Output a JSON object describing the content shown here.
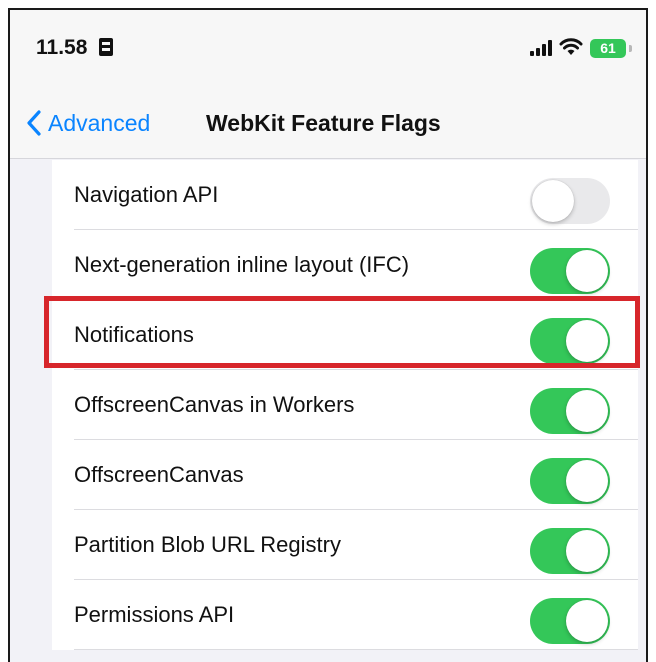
{
  "status_bar": {
    "time": "11.58",
    "battery": "61"
  },
  "nav": {
    "back_label": "Advanced",
    "title": "WebKit Feature Flags"
  },
  "settings": [
    {
      "label": "Navigation API",
      "enabled": false
    },
    {
      "label": "Next-generation inline layout (IFC)",
      "enabled": true
    },
    {
      "label": "Notifications",
      "enabled": true,
      "highlighted": true
    },
    {
      "label": "OffscreenCanvas in Workers",
      "enabled": true
    },
    {
      "label": "OffscreenCanvas",
      "enabled": true
    },
    {
      "label": "Partition Blob URL Registry",
      "enabled": true
    },
    {
      "label": "Permissions API",
      "enabled": true
    }
  ],
  "colors": {
    "accent": "#0a84ff",
    "toggle_on": "#34c759",
    "toggle_off": "#e9e9eb",
    "highlight": "#d7262b"
  }
}
